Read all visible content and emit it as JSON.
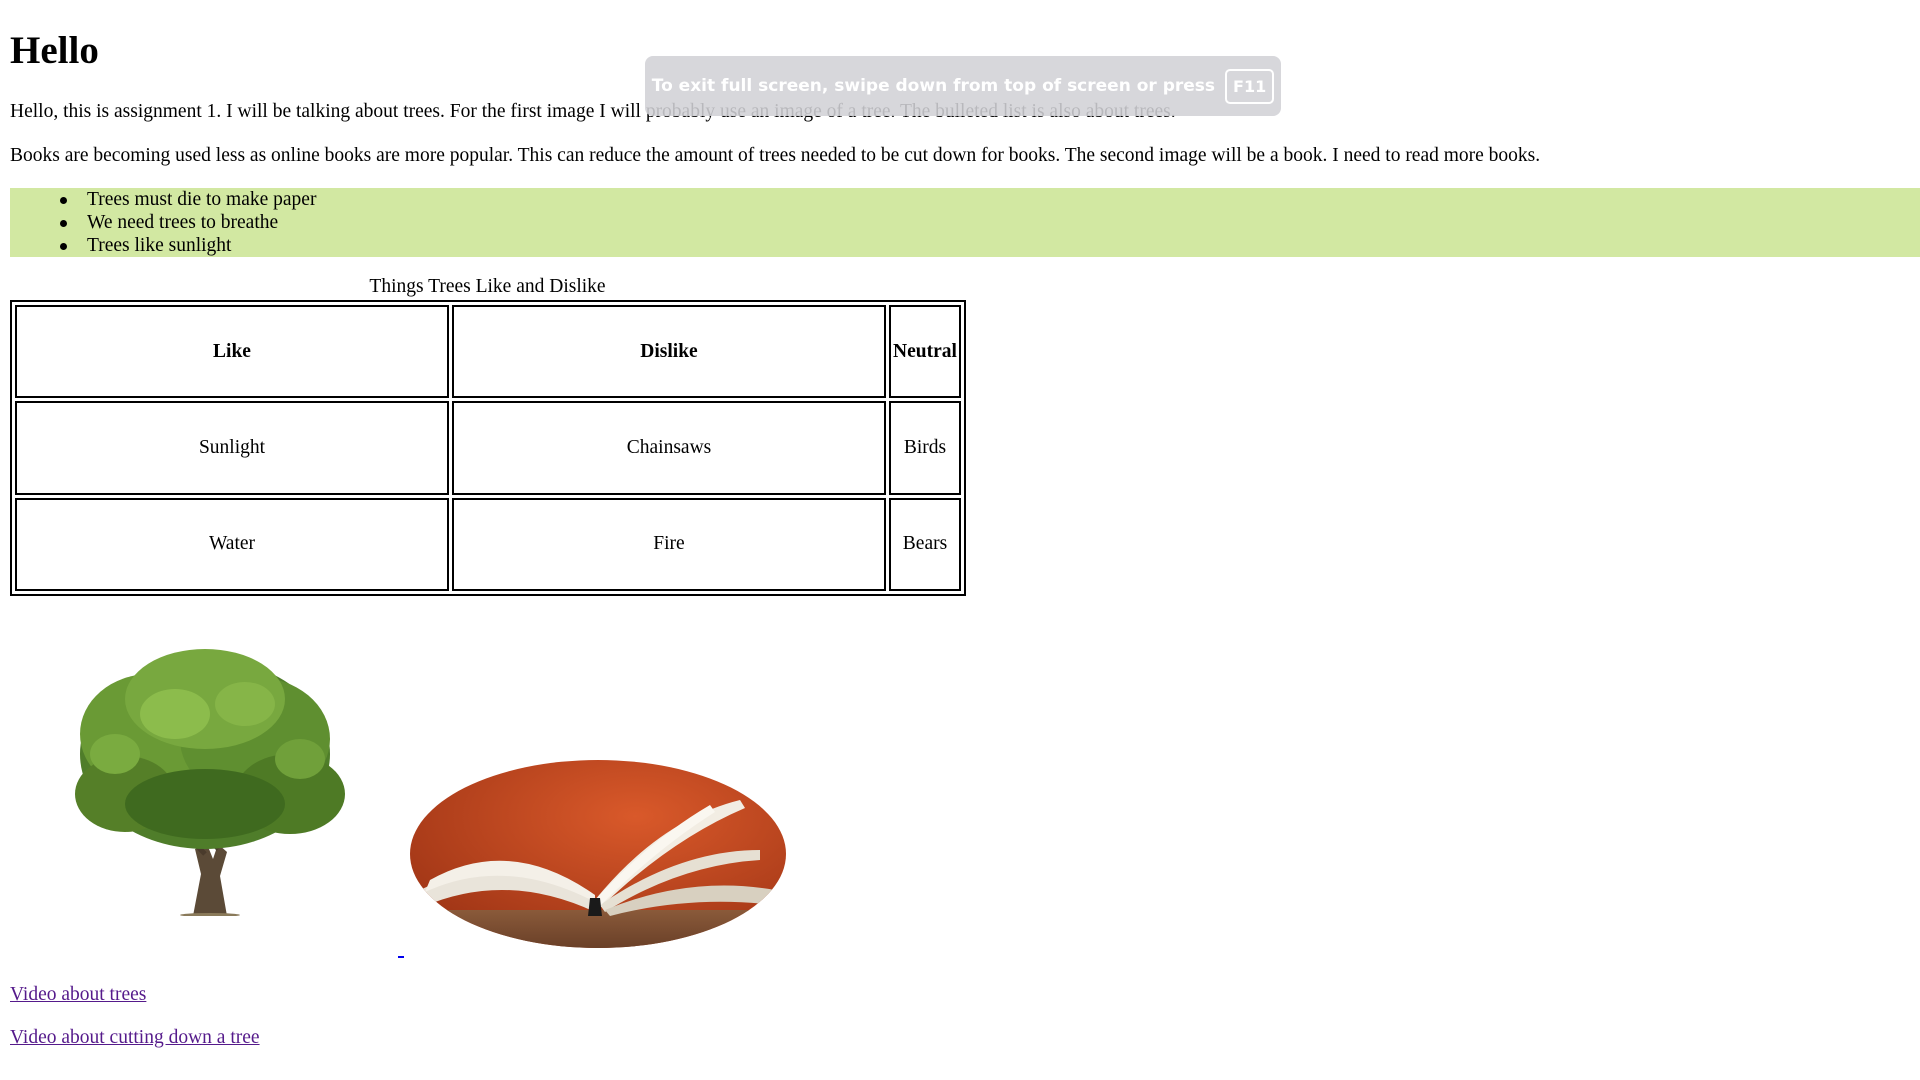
{
  "page": {
    "heading": "Hello",
    "paragraph1": "Hello, this is assignment 1. I will be talking about trees. For the first image I will probably use an image of a tree. The bulleted list is also about trees.",
    "paragraph2": "Books are becoming used less as online books are more popular. This can reduce the amount of trees needed to be cut down for books. The second image will be a book. I need to read more books.",
    "bullets": [
      "Trees must die to make paper",
      "We need trees to breathe",
      "Trees like sunlight"
    ],
    "table": {
      "caption": "Things Trees Like and Dislike",
      "headers": [
        "Like",
        "Dislike",
        "Neutral"
      ],
      "rows": [
        [
          "Sunlight",
          "Chainsaws",
          "Birds"
        ],
        [
          "Water",
          "Fire",
          "Bears"
        ]
      ]
    },
    "images": {
      "first": "tree-image",
      "second": "book-image"
    },
    "links": {
      "video1": "Video about trees",
      "video2": "Video about cutting down a tree"
    }
  },
  "fullscreen_notice": {
    "text": "To exit full screen, swipe down from top of screen or press",
    "key": "F11"
  },
  "colors": {
    "bullet_background": "#d2e8a2",
    "visited_link": "#551a8b",
    "book_cover": "#c4491f"
  }
}
